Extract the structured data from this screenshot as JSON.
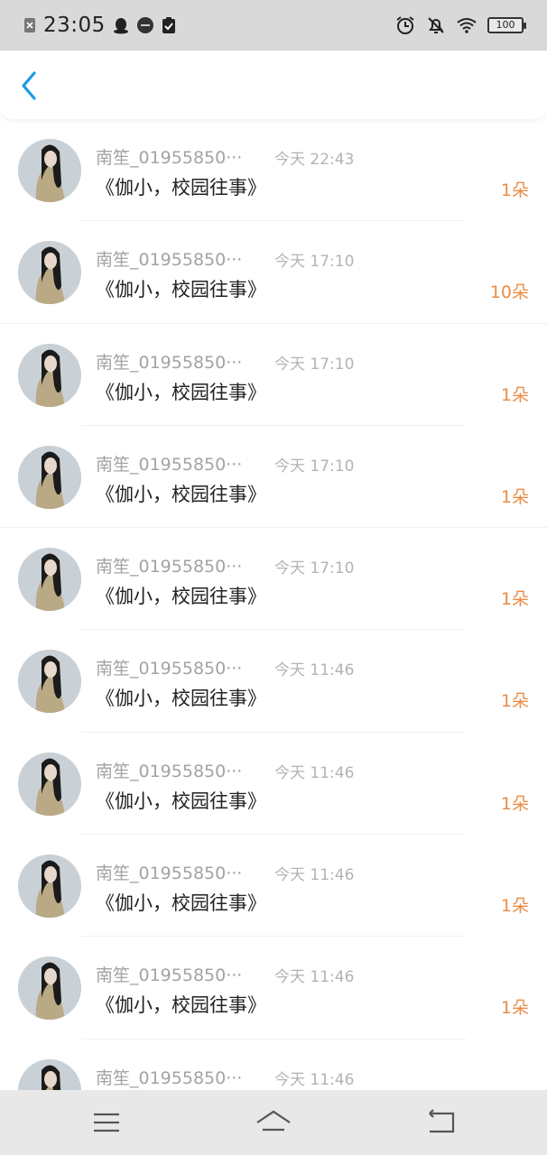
{
  "status_bar": {
    "time": "23:05",
    "battery": "100"
  },
  "list": [
    {
      "name": "南笙_01955850···",
      "time": "今天 22:43",
      "title": "《伽小，校园往事》",
      "count": "1朵"
    },
    {
      "name": "南笙_01955850···",
      "time": "今天 17:10",
      "title": "《伽小，校园往事》",
      "count": "10朵"
    },
    {
      "name": "南笙_01955850···",
      "time": "今天 17:10",
      "title": "《伽小，校园往事》",
      "count": "1朵"
    },
    {
      "name": "南笙_01955850···",
      "time": "今天 17:10",
      "title": "《伽小，校园往事》",
      "count": "1朵"
    },
    {
      "name": "南笙_01955850···",
      "time": "今天 17:10",
      "title": "《伽小，校园往事》",
      "count": "1朵"
    },
    {
      "name": "南笙_01955850···",
      "time": "今天 11:46",
      "title": "《伽小，校园往事》",
      "count": "1朵"
    },
    {
      "name": "南笙_01955850···",
      "time": "今天 11:46",
      "title": "《伽小，校园往事》",
      "count": "1朵"
    },
    {
      "name": "南笙_01955850···",
      "time": "今天 11:46",
      "title": "《伽小，校园往事》",
      "count": "1朵"
    },
    {
      "name": "南笙_01955850···",
      "time": "今天 11:46",
      "title": "《伽小，校园往事》",
      "count": "1朵"
    },
    {
      "name": "南笙_01955850···",
      "time": "今天 11:46",
      "title": "",
      "count": ""
    }
  ],
  "colors": {
    "accent": "#1a9be6",
    "count": "#e98d47"
  },
  "icons": {
    "back": "back-chevron-icon",
    "menu": "menu-icon",
    "home": "home-icon",
    "return": "return-icon"
  }
}
